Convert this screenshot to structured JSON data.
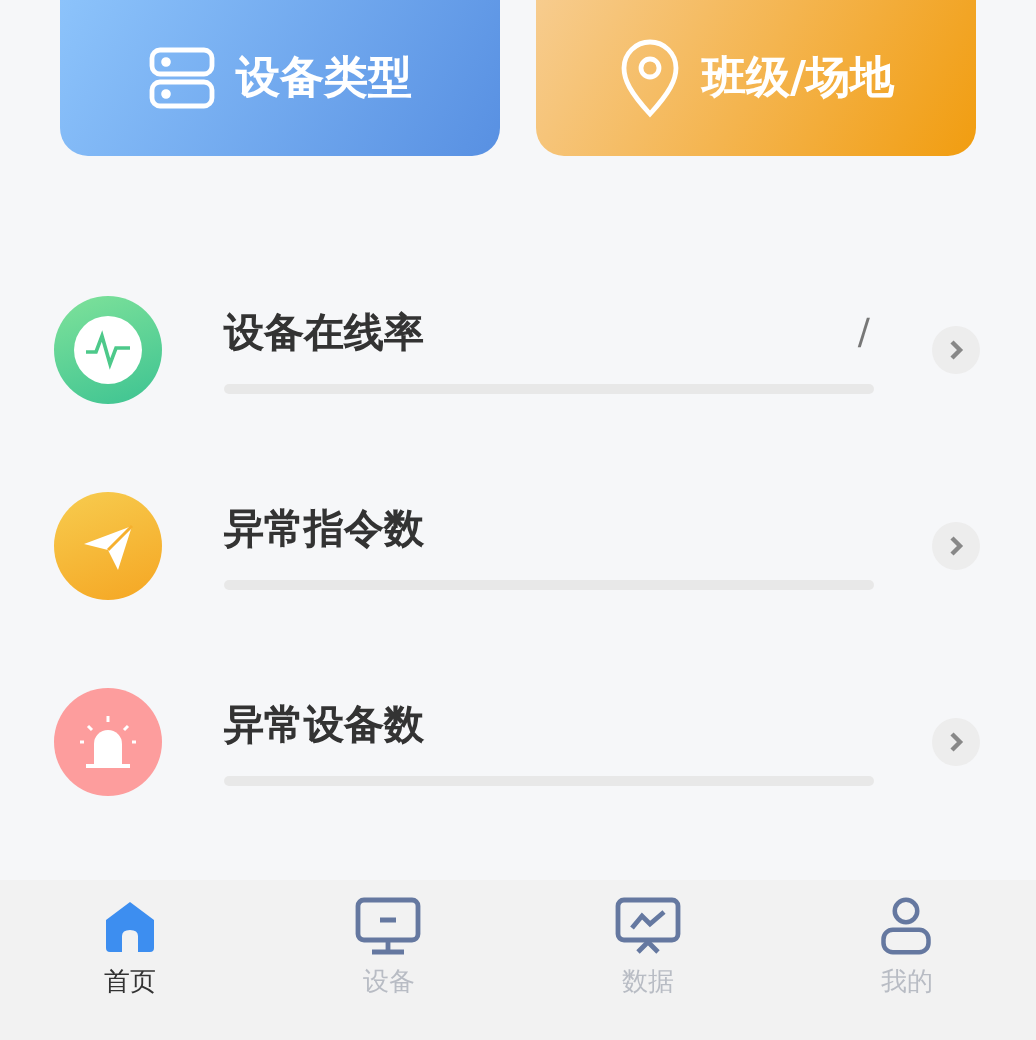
{
  "shortcuts": [
    {
      "kind": "device",
      "label": "设备类型"
    },
    {
      "kind": "location",
      "label": "班级/场地"
    }
  ],
  "stats": [
    {
      "kind": "pulse",
      "title": "设备在线率",
      "value": "/"
    },
    {
      "kind": "plane",
      "title": "异常指令数"
    },
    {
      "kind": "alarm",
      "title": "异常设备数"
    }
  ],
  "tabs": [
    {
      "kind": "home",
      "label": "首页",
      "selected": true
    },
    {
      "kind": "monitor",
      "label": "设备",
      "selected": false
    },
    {
      "kind": "chart",
      "label": "数据",
      "selected": false
    },
    {
      "kind": "user",
      "label": "我的",
      "selected": false
    }
  ]
}
